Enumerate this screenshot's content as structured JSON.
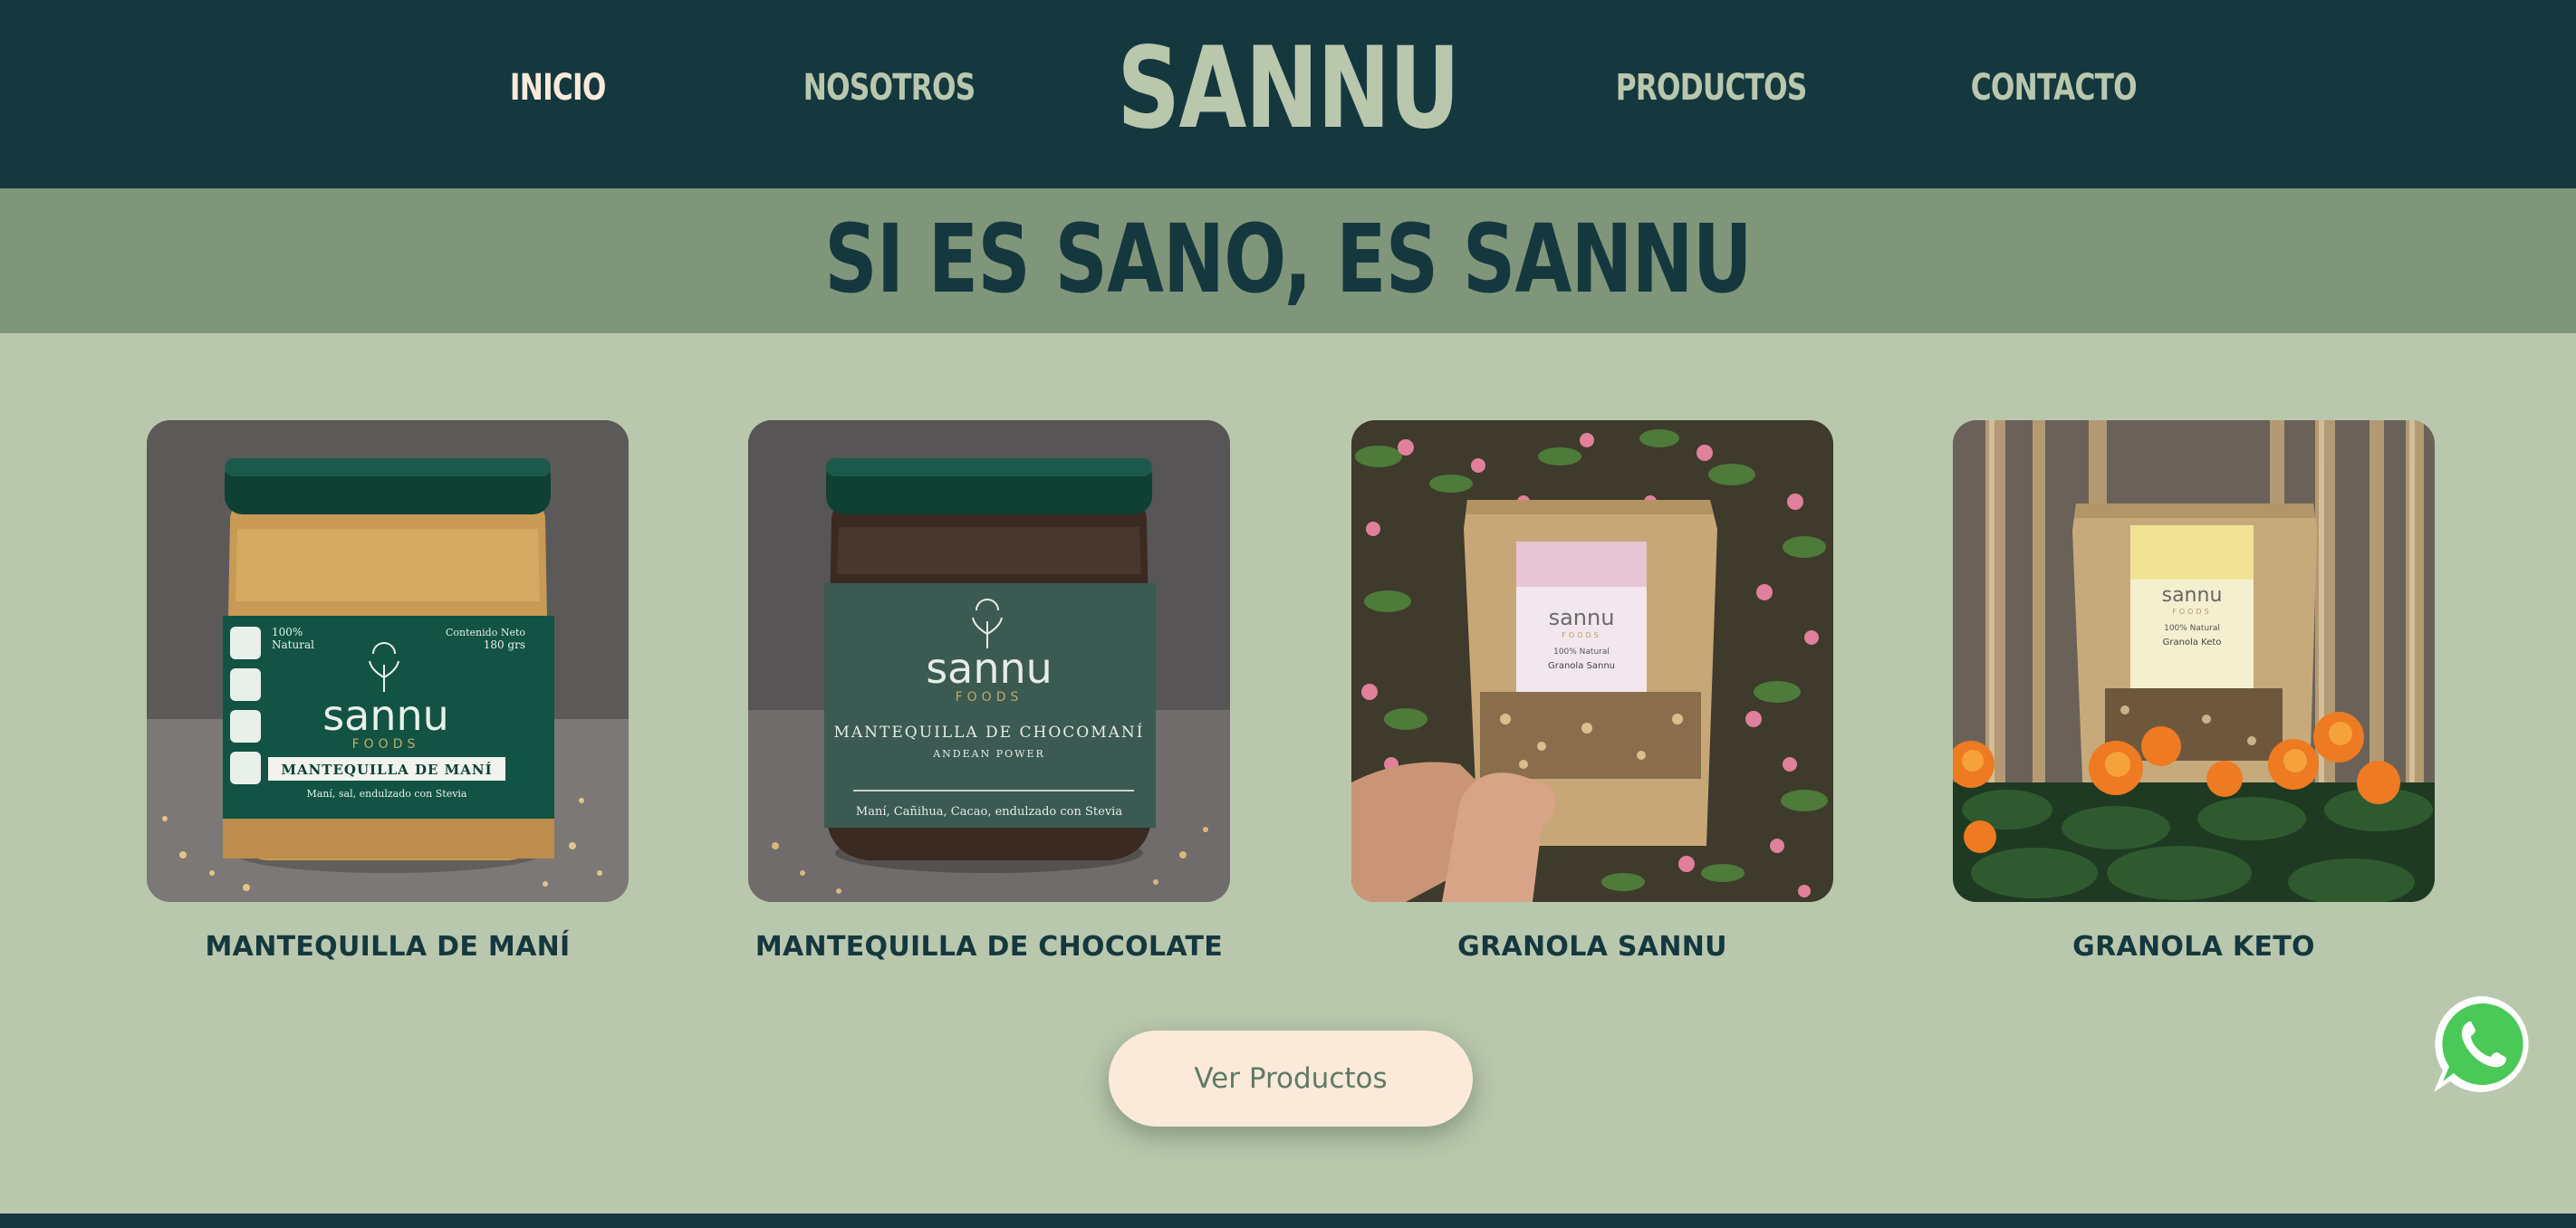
{
  "nav": {
    "brand": "SANNU",
    "links": [
      {
        "label": "INICIO",
        "active": true
      },
      {
        "label": "NOSOTROS",
        "active": false
      },
      {
        "label": "PRODUCTOS",
        "active": false
      },
      {
        "label": "CONTACTO",
        "active": false
      }
    ]
  },
  "hero": {
    "tagline": "SI ES SANO, ES SANNU"
  },
  "products": [
    {
      "name": "MANTEQUILLA DE MANÍ",
      "label": {
        "claim_line1": "100%",
        "claim_line2": "Natural",
        "content_line1": "Contenido Neto",
        "content_line2": "180 grs",
        "brand": "sannu",
        "sub": "FOODS",
        "product": "MANTEQUILLA DE MANÍ",
        "ingredients": "Maní, sal, endulzado con Stevia"
      }
    },
    {
      "name": "MANTEQUILLA DE CHOCOLATE",
      "label": {
        "brand": "sannu",
        "sub": "FOODS",
        "product": "MANTEQUILLA DE CHOCOMANÍ",
        "tag": "ANDEAN POWER",
        "ingredients": "Maní, Cañihua, Cacao, endulzado con Stevia"
      }
    },
    {
      "name": "GRANOLA SANNU",
      "label": {
        "brand": "sannu",
        "sub": "FOODS",
        "claim": "100% Natural",
        "product": "Granola Sannu"
      }
    },
    {
      "name": "GRANOLA KETO",
      "label": {
        "brand": "sannu",
        "sub": "FOODS",
        "claim": "100% Natural",
        "product": "Granola Keto"
      }
    }
  ],
  "cta": {
    "label": "Ver Productos"
  },
  "colors": {
    "header_bg": "#15383f",
    "band_bg": "#80967a",
    "page_bg": "#b9c7ad",
    "nav_text": "#b9c7ad",
    "nav_active": "#fbe9da",
    "button_bg": "#fbe9da",
    "button_text": "#5e7b66",
    "whatsapp": "#4ac959"
  },
  "icons": {
    "floating": "whatsapp-icon"
  }
}
